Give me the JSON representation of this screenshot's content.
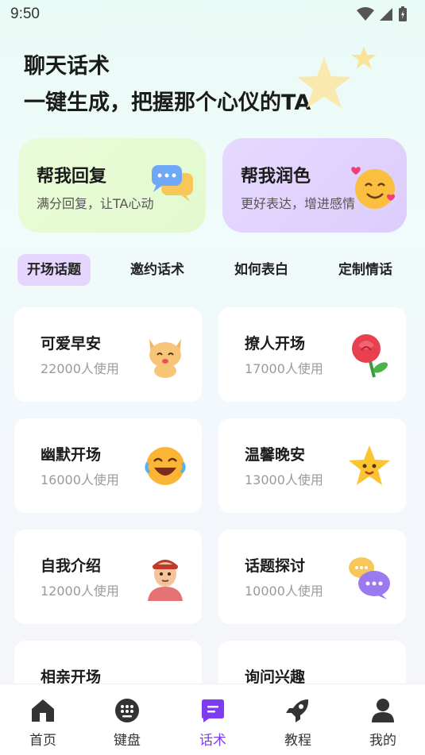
{
  "status_bar": {
    "time": "9:50"
  },
  "hero": {
    "title": "聊天话术",
    "subtitle": "一键生成，把握那个心仪的TA"
  },
  "features": [
    {
      "title": "帮我回复",
      "desc": "满分回复，让TA心动",
      "icon": "chat-bubbles-icon"
    },
    {
      "title": "帮我润色",
      "desc": "更好表达，增进感情",
      "icon": "smiling-face-hearts-icon"
    }
  ],
  "tabs": [
    {
      "label": "开场话题",
      "active": true
    },
    {
      "label": "邀约话术",
      "active": false
    },
    {
      "label": "如何表白",
      "active": false
    },
    {
      "label": "定制情话",
      "active": false
    }
  ],
  "cards": [
    {
      "title": "可爱早安",
      "usage": "22000人使用",
      "icon": "cute-cat-icon"
    },
    {
      "title": "撩人开场",
      "usage": "17000人使用",
      "icon": "rose-icon"
    },
    {
      "title": "幽默开场",
      "usage": "16000人使用",
      "icon": "laughing-face-icon"
    },
    {
      "title": "温馨晚安",
      "usage": "13000人使用",
      "icon": "star-face-icon"
    },
    {
      "title": "自我介绍",
      "usage": "12000人使用",
      "icon": "person-icon"
    },
    {
      "title": "话题探讨",
      "usage": "10000人使用",
      "icon": "speech-bubbles-icon"
    },
    {
      "title": "相亲开场",
      "usage": "",
      "icon": "flowers-icon"
    },
    {
      "title": "询问兴趣",
      "usage": "",
      "icon": "photo-card-icon"
    }
  ],
  "nav": [
    {
      "label": "首页",
      "icon": "home-icon",
      "active": false
    },
    {
      "label": "键盘",
      "icon": "keyboard-icon",
      "active": false
    },
    {
      "label": "话术",
      "icon": "message-icon",
      "active": true
    },
    {
      "label": "教程",
      "icon": "rocket-icon",
      "active": false
    },
    {
      "label": "我的",
      "icon": "profile-icon",
      "active": false
    }
  ],
  "colors": {
    "accent": "#7d3cf2",
    "tab_active_bg": "#e6d6ff",
    "reply_card": "#e6fbd4",
    "polish_card": "#e1d3fd"
  }
}
